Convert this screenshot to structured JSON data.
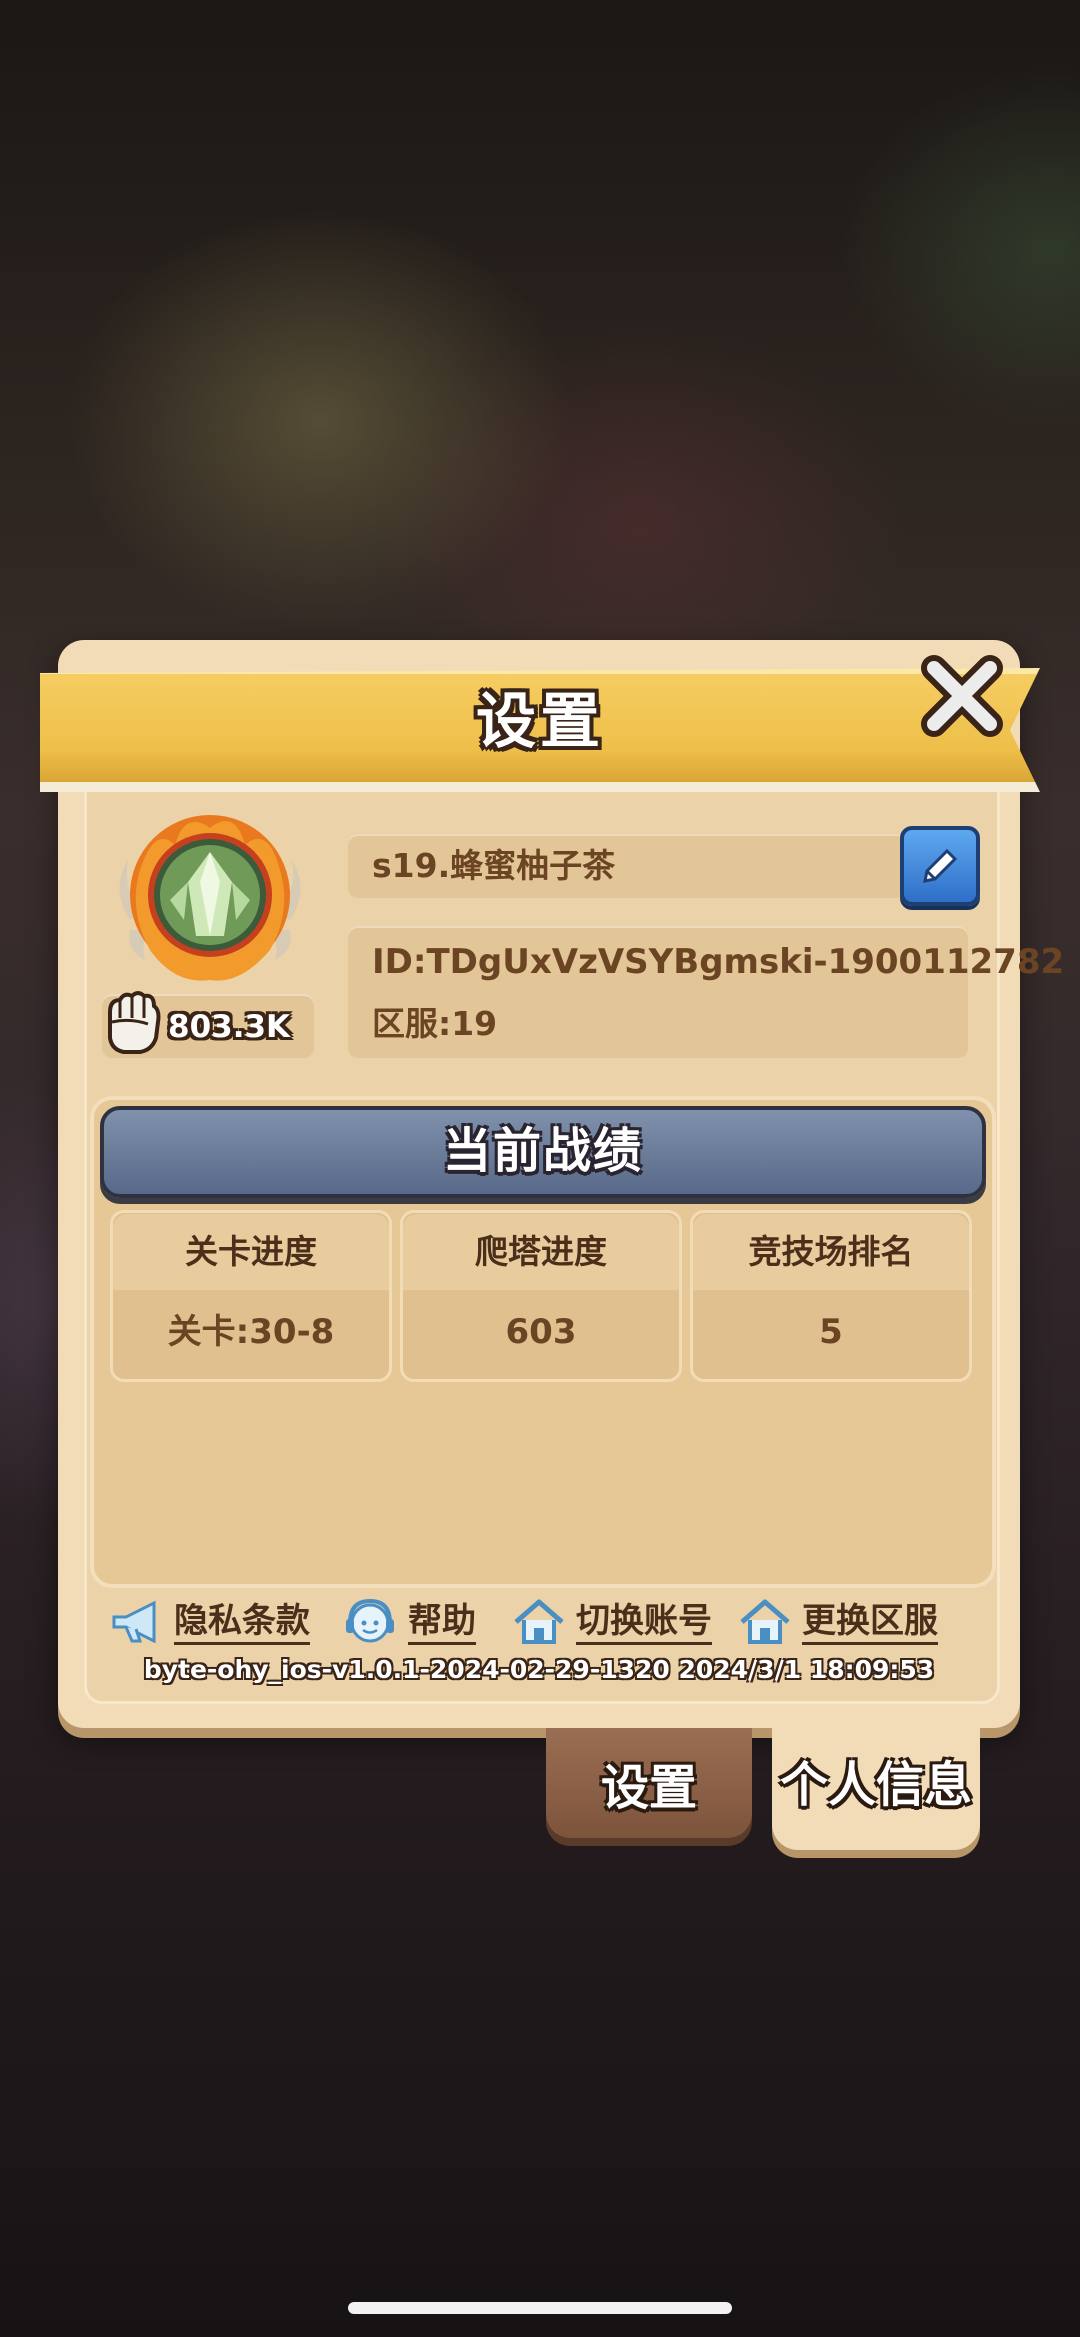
{
  "header": {
    "title": "设置"
  },
  "profile": {
    "power": "803.3K",
    "name": "s19.蜂蜜柚子茶",
    "id_line": "ID:TDgUxVzVSYBgmski-1900112782",
    "server_line": "区服:19",
    "avatar_icon": "crystal-flame-avatar-icon"
  },
  "record": {
    "title": "当前战绩",
    "stats": [
      {
        "label": "关卡进度",
        "value": "关卡:30-8"
      },
      {
        "label": "爬塔进度",
        "value": "603"
      },
      {
        "label": "竞技场排名",
        "value": "5"
      }
    ]
  },
  "links": [
    {
      "label": "隐私条款",
      "icon": "megaphone-icon"
    },
    {
      "label": "帮助",
      "icon": "support-headset-icon"
    },
    {
      "label": "切换账号",
      "icon": "home-icon"
    },
    {
      "label": "更换区服",
      "icon": "home-icon"
    }
  ],
  "version": "byte-ohy_ios-v1.0.1-2024-02-29-1320 2024/3/1 18:09:53",
  "tabs": {
    "settings": "设置",
    "profile": "个人信息"
  },
  "colors": {
    "accent": "#f2c44f",
    "panel": "#f1dcb7",
    "text": "#6b4423",
    "edit_button": "#3b82d8"
  }
}
